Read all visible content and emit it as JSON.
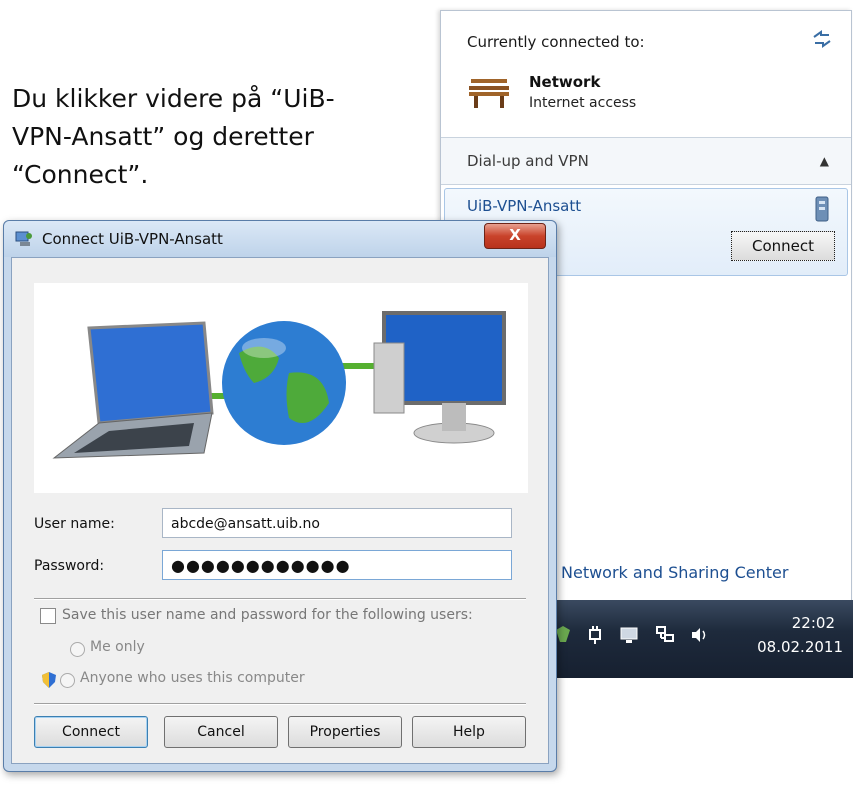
{
  "instruction": {
    "line1": "Du klikker videre på “UiB-",
    "line2": "VPN-Ansatt” og deretter",
    "line3": "“Connect”."
  },
  "flyout": {
    "connected_label": "Currently connected to:",
    "network_name": "Network",
    "network_status": "Internet access",
    "section_label": "Dial-up and VPN",
    "vpn_name": "UiB-VPN-Ansatt",
    "connect_label": "Connect",
    "sharing_center_link": "Network and Sharing Center"
  },
  "taskbar": {
    "time": "22:02",
    "date": "08.02.2011"
  },
  "dialog": {
    "title": "Connect UiB-VPN-Ansatt",
    "close_label": "X",
    "username_label": "User name:",
    "username_value": "abcde@ansatt.uib.no",
    "password_label": "Password:",
    "password_value": "●●●●●●●●●●●●",
    "save_label": "Save this user name and password for the following users:",
    "me_only_label": "Me only",
    "anyone_label": "Anyone who uses this computer",
    "buttons": {
      "connect": "Connect",
      "cancel": "Cancel",
      "properties": "Properties",
      "help": "Help"
    }
  },
  "colors": {
    "link": "#1d4f91",
    "dialog_frame": "#c6d8ec",
    "taskbar": "#1e2a3c"
  }
}
